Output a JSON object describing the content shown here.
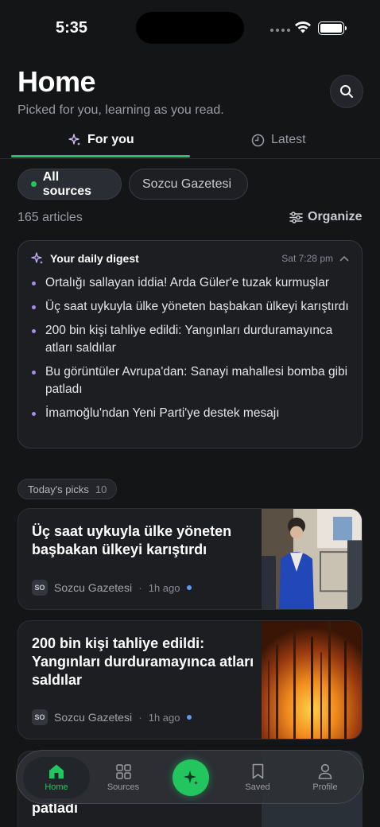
{
  "status": {
    "time": "5:35"
  },
  "header": {
    "title": "Home",
    "subtitle": "Picked for you, learning as you read."
  },
  "tabs": [
    {
      "label": "For you",
      "icon": "sparkle-icon",
      "active": true
    },
    {
      "label": "Latest",
      "icon": "clock-icon",
      "active": false
    }
  ],
  "filters": [
    {
      "label": "All sources",
      "active": true
    },
    {
      "label": "Sozcu Gazetesi",
      "active": false
    }
  ],
  "list": {
    "count_label": "165 articles",
    "organize_label": "Organize"
  },
  "digest": {
    "title": "Your daily digest",
    "time": "Sat 7:28 pm",
    "items": [
      "Ortalığı sallayan iddia! Arda Güler'e tuzak kurmuşlar",
      "Üç saat uykuyla ülke yöneten başbakan ülkeyi karıştırdı",
      "200 bin kişi tahliye edildi: Yangınları durduramayınca atları saldılar",
      "Bu görüntüler Avrupa'dan: Sanayi mahallesi bomba gibi patladı",
      "İmamoğlu'ndan Yeni Parti'ye destek mesajı"
    ]
  },
  "picks": {
    "label": "Today's picks",
    "count": "10"
  },
  "articles": [
    {
      "headline": "Üç saat uykuyla ülke yöneten başbakan ülkeyi karıştırdı",
      "source_abbr": "SO",
      "source": "Sozcu Gazetesi",
      "time": "1h ago"
    },
    {
      "headline": "200 bin kişi tahliye edildi: Yangınları durduramayınca atları saldılar",
      "source_abbr": "SO",
      "source": "Sozcu Gazetesi",
      "time": "1h ago"
    },
    {
      "headline": "patladı"
    }
  ],
  "nav": {
    "home": "Home",
    "sources": "Sources",
    "saved": "Saved",
    "profile": "Profile"
  },
  "colors": {
    "accent": "#22c55e",
    "background": "#141517",
    "card": "#1c1e22",
    "bullet": "#a88bf2",
    "unread": "#5b9bf5"
  }
}
